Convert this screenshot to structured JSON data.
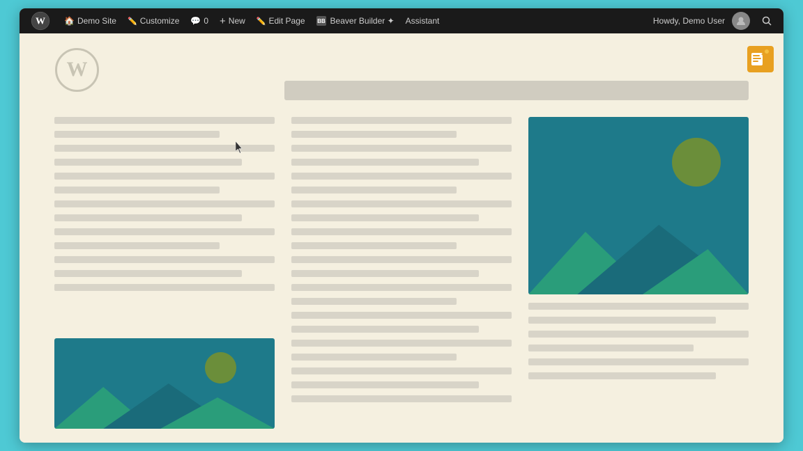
{
  "adminBar": {
    "wpLogoAlt": "WordPress",
    "items": [
      {
        "id": "demo-site",
        "label": "Demo Site",
        "icon": "🏠"
      },
      {
        "id": "customize",
        "label": "Customize",
        "icon": "✏️"
      },
      {
        "id": "comments",
        "label": "0",
        "icon": "💬"
      },
      {
        "id": "new",
        "label": "New",
        "icon": "+"
      },
      {
        "id": "edit-page",
        "label": "Edit Page",
        "icon": "✏️"
      },
      {
        "id": "beaver-builder",
        "label": "Beaver Builder ✦",
        "icon": ""
      },
      {
        "id": "assistant",
        "label": "Assistant",
        "icon": ""
      }
    ],
    "right": {
      "howdy": "Howdy, Demo User"
    }
  },
  "page": {
    "headerBarLabel": "Page Title Bar",
    "assistantIconLabel": "Assistant Icon"
  },
  "columns": [
    {
      "id": "col1",
      "lines": [
        "full",
        "short",
        "full",
        "medium",
        "full",
        "short",
        "full",
        "medium",
        "full",
        "short",
        "full",
        "medium",
        "full"
      ],
      "image": {
        "present": true,
        "position": "bottom",
        "altText": "Image placeholder col 1"
      }
    },
    {
      "id": "col2",
      "lines": [
        "full",
        "short",
        "full",
        "medium",
        "full",
        "short",
        "full",
        "medium",
        "full",
        "short",
        "full",
        "medium",
        "full",
        "short",
        "full",
        "medium",
        "full",
        "short"
      ],
      "image": {
        "present": false
      }
    },
    {
      "id": "col3",
      "image": {
        "present": true,
        "position": "top",
        "altText": "Image placeholder col 3"
      },
      "lines": [
        "full",
        "medium",
        "full",
        "short",
        "full",
        "medium"
      ]
    }
  ],
  "colors": {
    "background": "#f5f0e0",
    "adminBar": "#1a1a1a",
    "textLine": "#d8d4c8",
    "imageBg": "#1e7a8a",
    "mountainDark": "#1a6b7a",
    "mountainLight": "#2a9d7a",
    "sun": "#6b8e3a",
    "headerBar": "#d0ccc0",
    "browserBorder": "#4ec9d4"
  }
}
